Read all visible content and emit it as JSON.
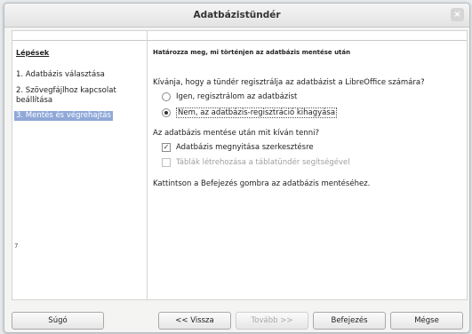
{
  "window": {
    "title": "Adatbázistündér",
    "close_glyph": "×"
  },
  "sidebar": {
    "title": "Lépések",
    "steps": [
      {
        "label": "1. Adatbázis választása"
      },
      {
        "label": "2. Szövegfájlhoz kapcsolat beállítása"
      },
      {
        "label": "3. Mentés és végrehajtás"
      }
    ],
    "side_number": "7"
  },
  "content": {
    "heading": "Határozza meg, mi történjen az adatbázis mentése után",
    "q1": "Kívánja, hogy a tündér regisztrálja az adatbázist a LibreOffice számára?",
    "q1_options": [
      {
        "label": "Igen, regisztrálom az adatbázist",
        "selected": false
      },
      {
        "label": "Nem, az adatbázis-regisztráció kihagyása",
        "selected": true
      }
    ],
    "q2": "Az adatbázis mentése után mit kíván tenni?",
    "q2_options": [
      {
        "label": "Adatbázis megnyitása szerkesztésre",
        "checked": true,
        "enabled": true
      },
      {
        "label": "Táblák létrehozása a táblatündér segítségével",
        "checked": false,
        "enabled": false
      }
    ],
    "note": "Kattintson a Befejezés gombra az adatbázis mentéséhez."
  },
  "buttons": {
    "help": "Súgó",
    "back": "<< Vissza",
    "next": "Tovább >>",
    "finish": "Befejezés",
    "cancel": "Mégse"
  },
  "icons": {
    "check_glyph": "✓"
  }
}
